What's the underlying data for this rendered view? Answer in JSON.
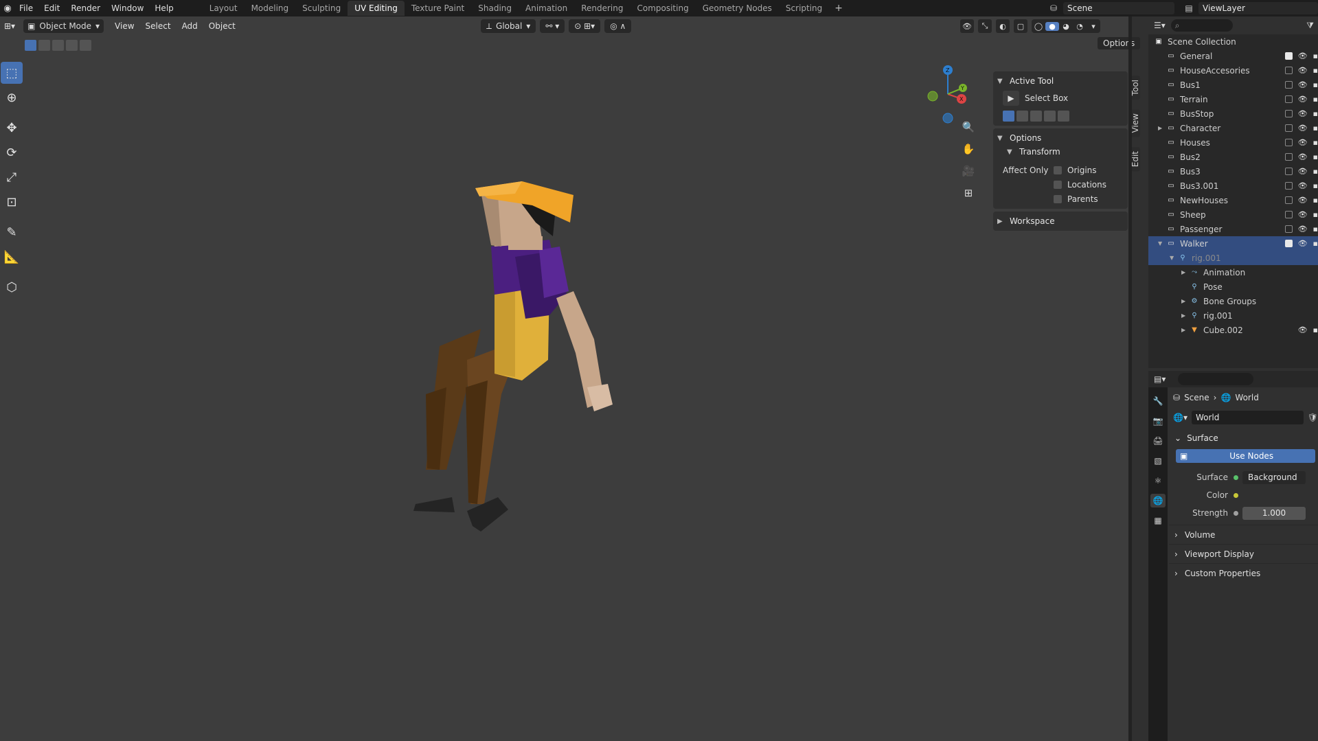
{
  "topbar": {
    "menus": [
      "File",
      "Edit",
      "Render",
      "Window",
      "Help"
    ],
    "workspaces": [
      "Layout",
      "Modeling",
      "Sculpting",
      "UV Editing",
      "Texture Paint",
      "Shading",
      "Animation",
      "Rendering",
      "Compositing",
      "Geometry Nodes",
      "Scripting"
    ],
    "active_workspace": "UV Editing",
    "scene": "Scene",
    "view_layer": "ViewLayer"
  },
  "viewport_header": {
    "mode": "Object Mode",
    "menus": [
      "View",
      "Select",
      "Add",
      "Object"
    ],
    "orientation": "Global",
    "options": "Options"
  },
  "npanel": {
    "tabs": [
      "Tool",
      "View",
      "Edit"
    ],
    "active_tool": {
      "title": "Active Tool",
      "tool": "Select Box"
    },
    "options": {
      "title": "Options",
      "transform": "Transform",
      "affect_only": "Affect Only",
      "checks": [
        "Origins",
        "Locations",
        "Parents"
      ]
    },
    "workspace": "Workspace"
  },
  "outliner": {
    "root": "Scene Collection",
    "rows": [
      {
        "label": "General",
        "checked": true
      },
      {
        "label": "HouseAccesories",
        "checked": false
      },
      {
        "label": "Bus1",
        "checked": false
      },
      {
        "label": "Terrain",
        "checked": false
      },
      {
        "label": "BusStop",
        "checked": false
      },
      {
        "label": "Character",
        "checked": false
      },
      {
        "label": "Houses",
        "checked": false
      },
      {
        "label": "Bus2",
        "checked": false
      },
      {
        "label": "Bus3",
        "checked": false
      },
      {
        "label": "Bus3.001",
        "checked": false
      },
      {
        "label": "NewHouses",
        "checked": false
      },
      {
        "label": "Sheep",
        "checked": false
      },
      {
        "label": "Passenger",
        "checked": false
      },
      {
        "label": "Walker",
        "checked": true
      },
      {
        "label": "rig.001"
      },
      {
        "label": "Animation"
      },
      {
        "label": "Pose"
      },
      {
        "label": "Bone Groups"
      },
      {
        "label": "rig.001"
      },
      {
        "label": "Cube.002"
      }
    ]
  },
  "properties": {
    "breadcrumb": [
      "Scene",
      "World"
    ],
    "world_name": "World",
    "surface_section": "Surface",
    "use_nodes": "Use Nodes",
    "surface_label": "Surface",
    "surface_value": "Background",
    "color_label": "Color",
    "strength_label": "Strength",
    "strength_value": "1.000",
    "closed_sections": [
      "Volume",
      "Viewport Display",
      "Custom Properties"
    ]
  },
  "colors": {
    "accent": "#4772b3",
    "hat": "#f0a428",
    "shirt": "#4b1f80",
    "vest": "#e0b03a",
    "skin": "#c7a68a",
    "pants": "#5a3a18"
  }
}
